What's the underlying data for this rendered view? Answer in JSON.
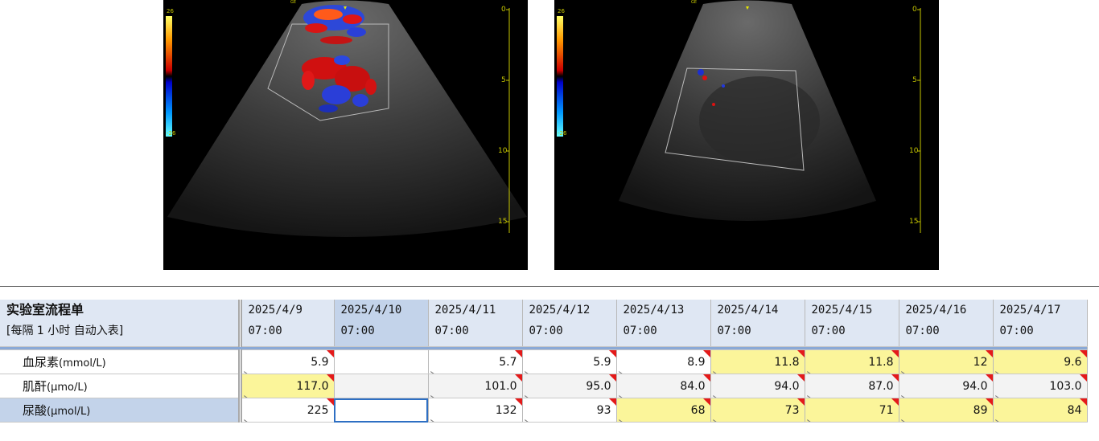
{
  "ultrasound": {
    "left": {
      "depth_ticks": [
        "0",
        "5",
        "10",
        "15"
      ],
      "scale_top": "26",
      "scale_bottom": "-26",
      "brand": "GE"
    },
    "right": {
      "depth_ticks": [
        "0",
        "5",
        "10",
        "15"
      ],
      "scale_top": "26",
      "scale_bottom": "-26",
      "brand": "GE"
    }
  },
  "flowsheet": {
    "title": "实验室流程单",
    "subtitle": "[每隔 1 小时 自动入表]",
    "columns": [
      {
        "date": "2025/4/9",
        "time": "07:00"
      },
      {
        "date": "2025/4/10",
        "time": "07:00"
      },
      {
        "date": "2025/4/11",
        "time": "07:00"
      },
      {
        "date": "2025/4/12",
        "time": "07:00"
      },
      {
        "date": "2025/4/13",
        "time": "07:00"
      },
      {
        "date": "2025/4/14",
        "time": "07:00"
      },
      {
        "date": "2025/4/15",
        "time": "07:00"
      },
      {
        "date": "2025/4/16",
        "time": "07:00"
      },
      {
        "date": "2025/4/17",
        "time": "07:00"
      }
    ],
    "rows": [
      {
        "name": "血尿素",
        "unit": "(mmol/L)",
        "values": [
          "5.9",
          "",
          "5.7",
          "5.9",
          "8.9",
          "11.8",
          "11.8",
          "12",
          "9.6"
        ]
      },
      {
        "name": "肌酐",
        "unit": "(μmo/L)",
        "values": [
          "117.0",
          "",
          "101.0",
          "95.0",
          "84.0",
          "94.0",
          "87.0",
          "94.0",
          "103.0"
        ]
      },
      {
        "name": "尿酸",
        "unit": "(μmol/L)",
        "values": [
          "225",
          "",
          "132",
          "93",
          "68",
          "73",
          "71",
          "89",
          "84"
        ]
      }
    ]
  },
  "colors": {
    "highlight": "#fbf59a",
    "header": "#dfe7f3",
    "selected": "#c3d3ea",
    "flag": "#e41a1a"
  }
}
